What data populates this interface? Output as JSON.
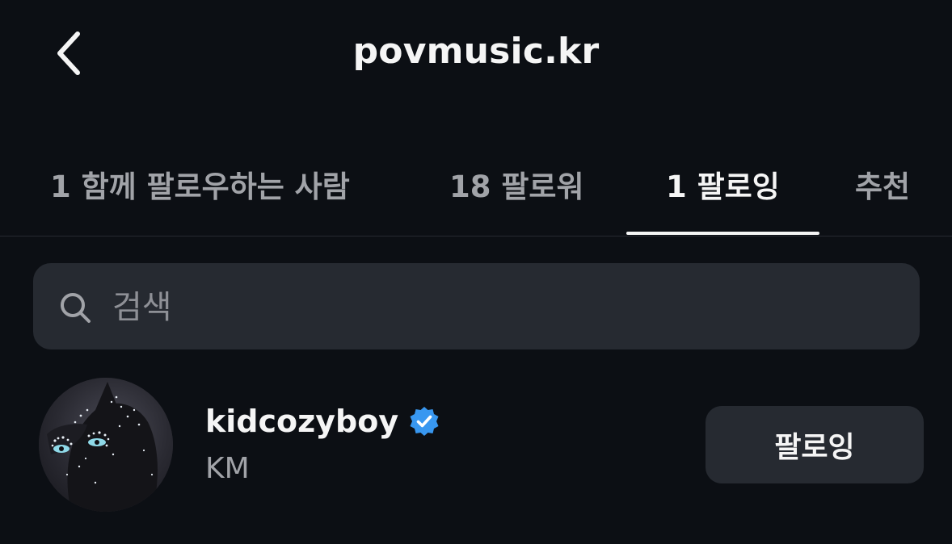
{
  "header": {
    "title": "povmusic.kr",
    "back_icon": "chevron-left-icon"
  },
  "tabs": [
    {
      "label": "1 함께 팔로우하는 사람",
      "active": false
    },
    {
      "label": "18 팔로워",
      "active": false
    },
    {
      "label": "1 팔로잉",
      "active": true
    },
    {
      "label": "추천",
      "active": false
    }
  ],
  "search": {
    "placeholder": "검색",
    "value": "",
    "icon": "search-icon"
  },
  "list": [
    {
      "username": "kidcozyboy",
      "verified": true,
      "full_name": "KM",
      "button_label": "팔로잉",
      "avatar": "black-cat-with-glitter-avatar"
    }
  ],
  "colors": {
    "background": "#0c0f14",
    "surface": "#262a31",
    "text_primary": "#f5f5f5",
    "text_secondary": "#a1a3a8",
    "verified_blue": "#3897f0"
  }
}
